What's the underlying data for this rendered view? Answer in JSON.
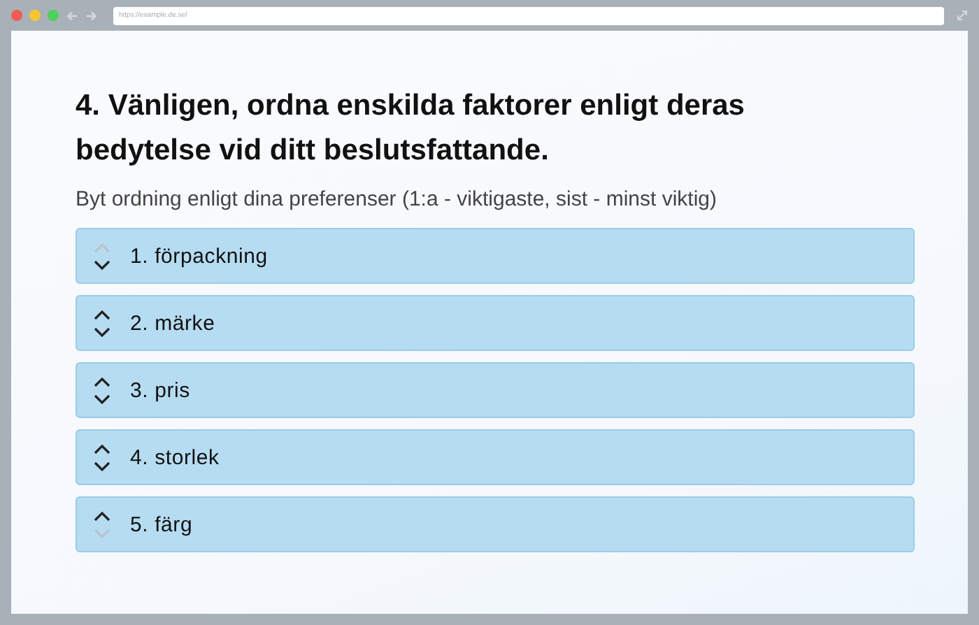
{
  "browser": {
    "url": "https://example.de.se/"
  },
  "question": {
    "title": "4. Vänligen, ordna enskilda faktorer enligt deras bedytelse vid ditt beslutsfattande.",
    "instruction": "Byt ordning enligt dina preferenser (1:a - viktigaste, sist - minst viktig)"
  },
  "items": [
    {
      "label": "1. förpackning",
      "up_disabled": true,
      "down_disabled": false
    },
    {
      "label": "2. märke",
      "up_disabled": false,
      "down_disabled": false
    },
    {
      "label": "3. pris",
      "up_disabled": false,
      "down_disabled": false
    },
    {
      "label": "4. storlek",
      "up_disabled": false,
      "down_disabled": false
    },
    {
      "label": "5. färg",
      "up_disabled": false,
      "down_disabled": true
    }
  ]
}
